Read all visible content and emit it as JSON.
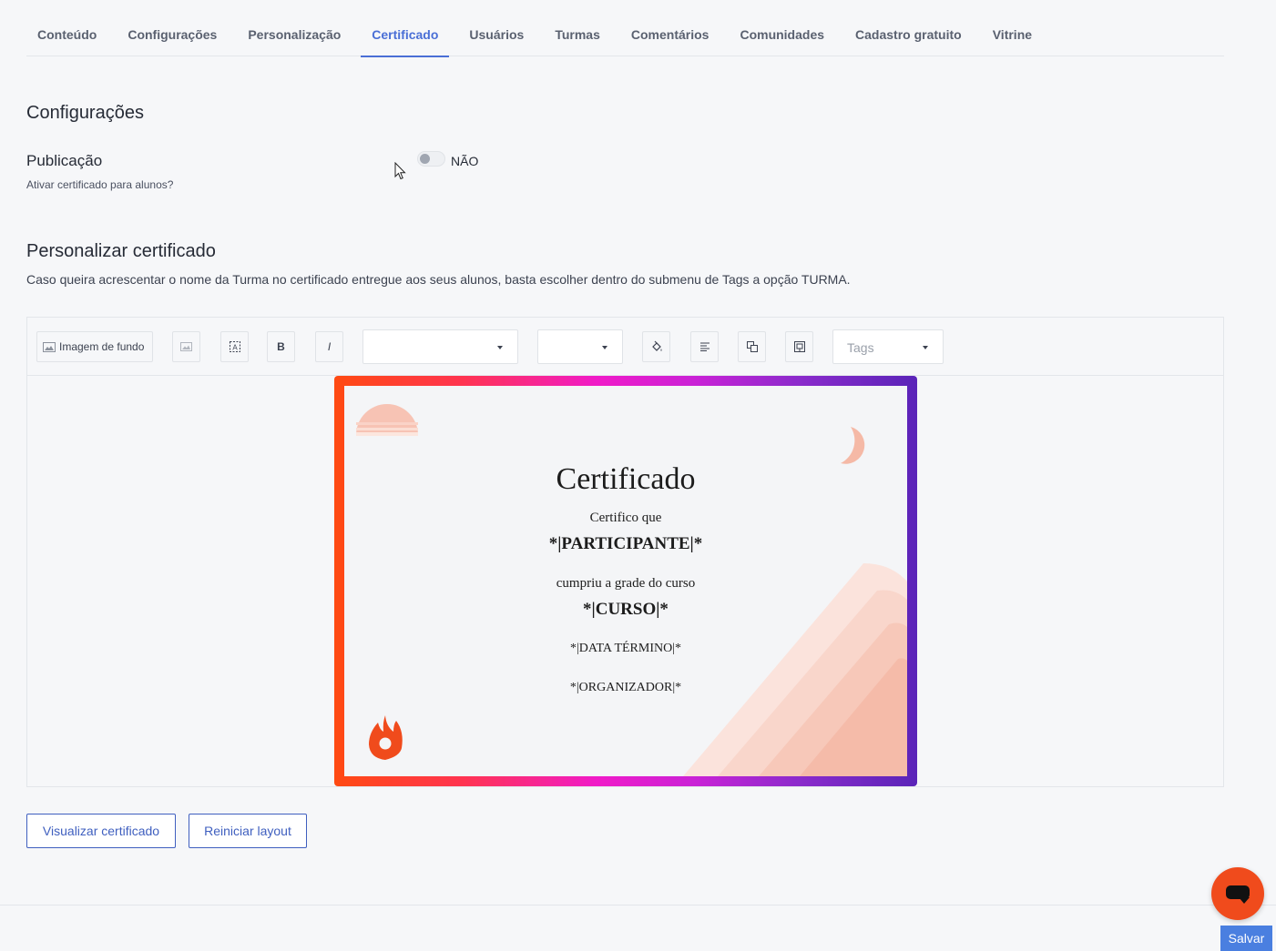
{
  "tabs": [
    {
      "label": "Conteúdo"
    },
    {
      "label": "Configurações"
    },
    {
      "label": "Personalização"
    },
    {
      "label": "Certificado"
    },
    {
      "label": "Usuários"
    },
    {
      "label": "Turmas"
    },
    {
      "label": "Comentários"
    },
    {
      "label": "Comunidades"
    },
    {
      "label": "Cadastro gratuito"
    },
    {
      "label": "Vitrine"
    }
  ],
  "active_tab": "Certificado",
  "settings": {
    "heading": "Configurações",
    "publication_label": "Publicação",
    "publication_question": "Ativar certificado para alunos?",
    "toggle_state": "NÃO"
  },
  "customize": {
    "heading": "Personalizar certificado",
    "description": "Caso queira acrescentar o nome da Turma no certificado entregue aos seus alunos, basta escolher dentro do submenu de Tags a opção TURMA."
  },
  "toolbar": {
    "background_image_label": "Imagem de fundo",
    "bold_label": "B",
    "italic_label": "I",
    "font_family_value": "",
    "font_size_value": "",
    "tags_placeholder": "Tags"
  },
  "certificate": {
    "title": "Certificado",
    "line1": "Certifico que",
    "participant": "*|PARTICIPANTE|*",
    "line2": "cumpriu a grade do curso",
    "course": "*|CURSO|*",
    "end_date": "*|DATA TÉRMINO|*",
    "organizer": "*|ORGANIZADOR|*"
  },
  "actions": {
    "preview_label": "Visualizar certificado",
    "reset_label": "Reiniciar layout",
    "save_label": "Salvar"
  },
  "colors": {
    "accent": "#4a6fd6",
    "brand_orange": "#f04b1c",
    "save_blue": "#4a7fe0"
  }
}
